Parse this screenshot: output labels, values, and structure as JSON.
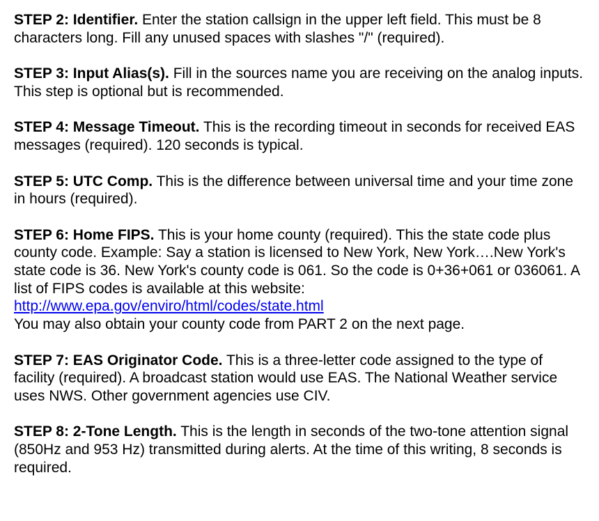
{
  "steps": {
    "s2": {
      "label": "STEP 2:  Identifier.",
      "text": "  Enter the station callsign in the upper left field.  This must be 8 characters long.  Fill any unused spaces with slashes \"/\" (required)."
    },
    "s3": {
      "label": "STEP 3:  Input Alias(s).",
      "text": "  Fill in the sources name you are receiving on the analog inputs. This step is optional but is recommended."
    },
    "s4": {
      "label": "STEP 4:  Message Timeout.",
      "text": "  This is the recording timeout in seconds for received EAS messages (required).  120 seconds is typical."
    },
    "s5": {
      "label": "STEP 5: UTC Comp.",
      "text": "  This is the difference between universal time and your time zone in hours (required)."
    },
    "s6": {
      "label": "STEP 6:  Home FIPS.",
      "text_before_link": "  This is your home county (required).  This the state code plus county code. Example: Say a station is licensed to New York, New York….New York's state code is 36.  New York's county code is 061.  So the code is 0+36+061 or 036061.  A list of FIPS codes is available at this website: ",
      "link_text": "http://www.epa.gov/enviro/html/codes/state.html",
      "link_href": "http://www.epa.gov/enviro/html/codes/state.html",
      "text_after_link": "You may also obtain your county code from PART 2 on the next page."
    },
    "s7": {
      "label": "STEP 7:  EAS Originator Code.",
      "text": "  This is a three-letter code assigned to the type of facility (required).  A broadcast station would use EAS.  The National Weather service uses NWS.  Other government agencies use CIV."
    },
    "s8": {
      "label": "STEP 8:  2-Tone Length.",
      "text": "  This is the length in seconds of the two-tone attention signal (850Hz and 953 Hz) transmitted during alerts.  At the time of this writing, 8 seconds is required."
    }
  }
}
